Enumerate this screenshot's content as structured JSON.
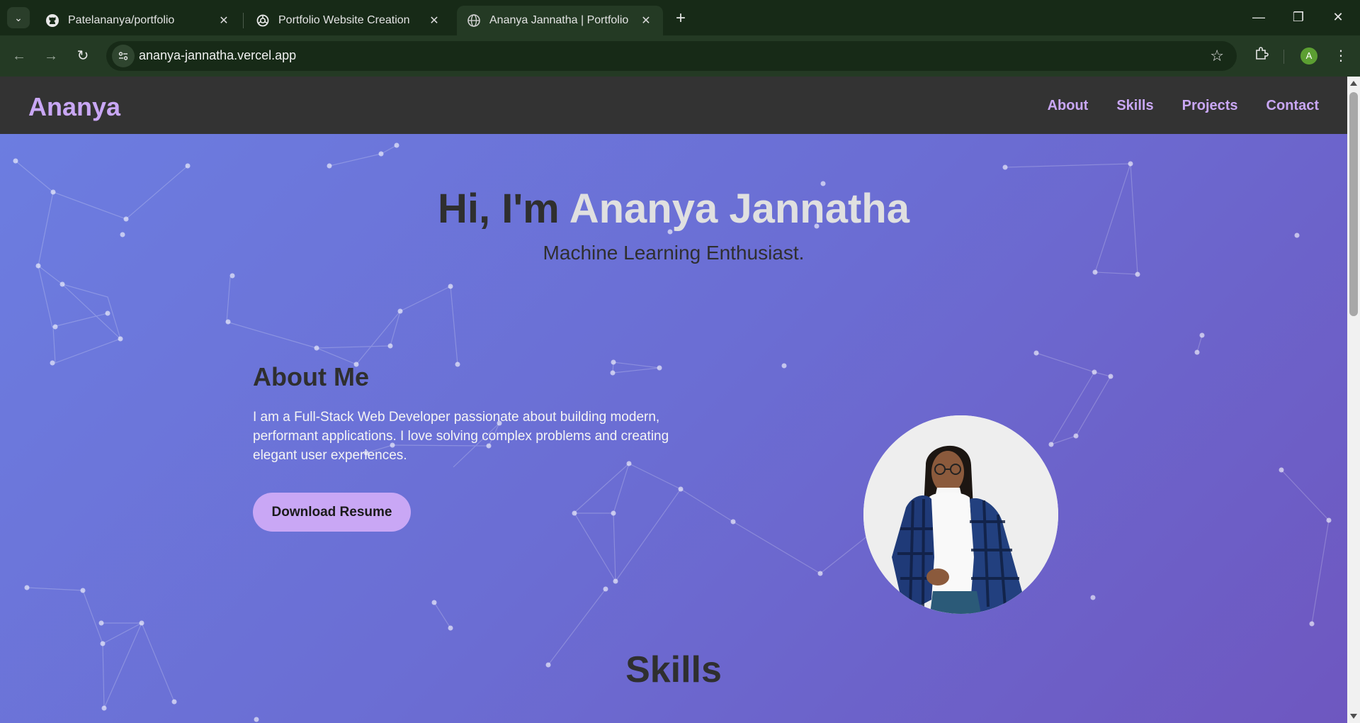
{
  "browser": {
    "tabs": [
      {
        "title": "Patelananya/portfolio",
        "icon": "github-icon",
        "active": false
      },
      {
        "title": "Portfolio Website Creation",
        "icon": "openai-icon",
        "active": false
      },
      {
        "title": "Ananya Jannatha | Portfolio",
        "icon": "globe-icon",
        "active": true
      }
    ],
    "url": "ananya-jannatha.vercel.app",
    "profile_initial": "A"
  },
  "site": {
    "logo": "Ananya",
    "nav": [
      "About",
      "Skills",
      "Projects",
      "Contact"
    ],
    "hero": {
      "greeting": "Hi, I'm ",
      "name": "Ananya Jannatha",
      "subtitle": "Machine Learning Enthusiast."
    },
    "about": {
      "heading": "About Me",
      "text": "I am a Full-Stack Web Developer passionate about building modern, performant applications. I love solving complex problems and creating elegant user experiences.",
      "button": "Download Resume"
    },
    "skills_heading": "Skills"
  },
  "colors": {
    "accent": "#c9a7f5",
    "header_bg": "#333333",
    "hero_gradient_start": "#6c7de0",
    "hero_gradient_end": "#6e57c0"
  }
}
